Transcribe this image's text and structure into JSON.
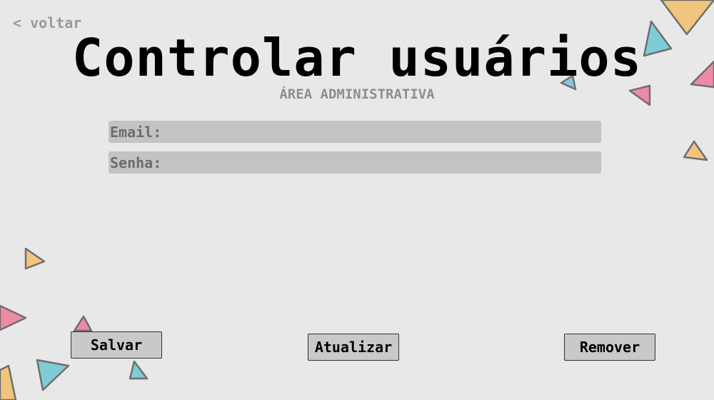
{
  "nav": {
    "back_label": "< voltar"
  },
  "header": {
    "title": "Controlar usuários",
    "subtitle": "ÁREA ADMINISTRATIVA"
  },
  "form": {
    "email_label": "Email:",
    "email_value": "",
    "password_label": "Senha:",
    "password_value": ""
  },
  "actions": {
    "save_label": "Salvar",
    "update_label": "Atualizar",
    "remove_label": "Remover"
  },
  "colors": {
    "background": "#e8e8e8",
    "field_background": "#c3c3c3",
    "button_background": "#c9c9c9",
    "triangle_yellow": "#f2c57c",
    "triangle_blue": "#7ecdd6",
    "triangle_pink": "#ec8aa4"
  }
}
